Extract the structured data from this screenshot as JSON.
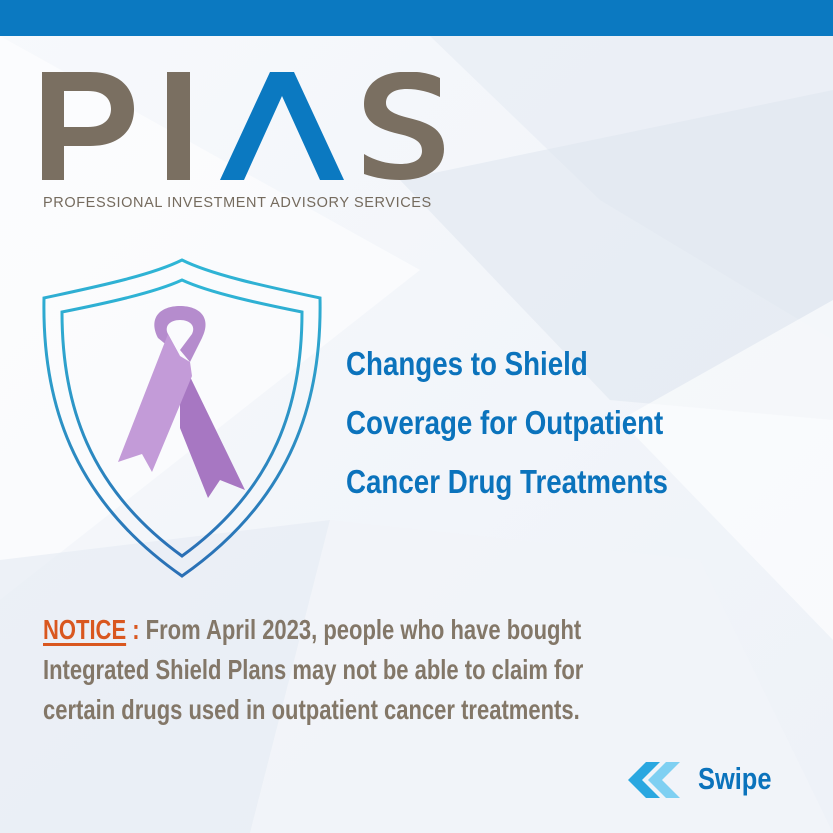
{
  "brand": {
    "logo_text": "PIAS",
    "tagline": "PROFESSIONAL INVESTMENT ADVISORY SERVICES",
    "logo_color": "#7a6f61",
    "accent_color": "#0b79c1"
  },
  "headline": {
    "lines": [
      "Changes to Shield",
      "Coverage for Outpatient",
      "Cancer Drug Treatments"
    ]
  },
  "notice": {
    "label": "NOTICE",
    "colon": " : ",
    "line1": "From April 2023, people who have bought",
    "line2": "Integrated Shield Plans may not be able to claim for",
    "line3": "certain drugs used in outpatient cancer treatments."
  },
  "swipe": {
    "label": "Swipe",
    "icon": "double-chevron-left-icon"
  },
  "illustration": {
    "shield_icon": "shield-icon",
    "ribbon_icon": "awareness-ribbon-icon",
    "ribbon_color": "#b58ccd"
  }
}
